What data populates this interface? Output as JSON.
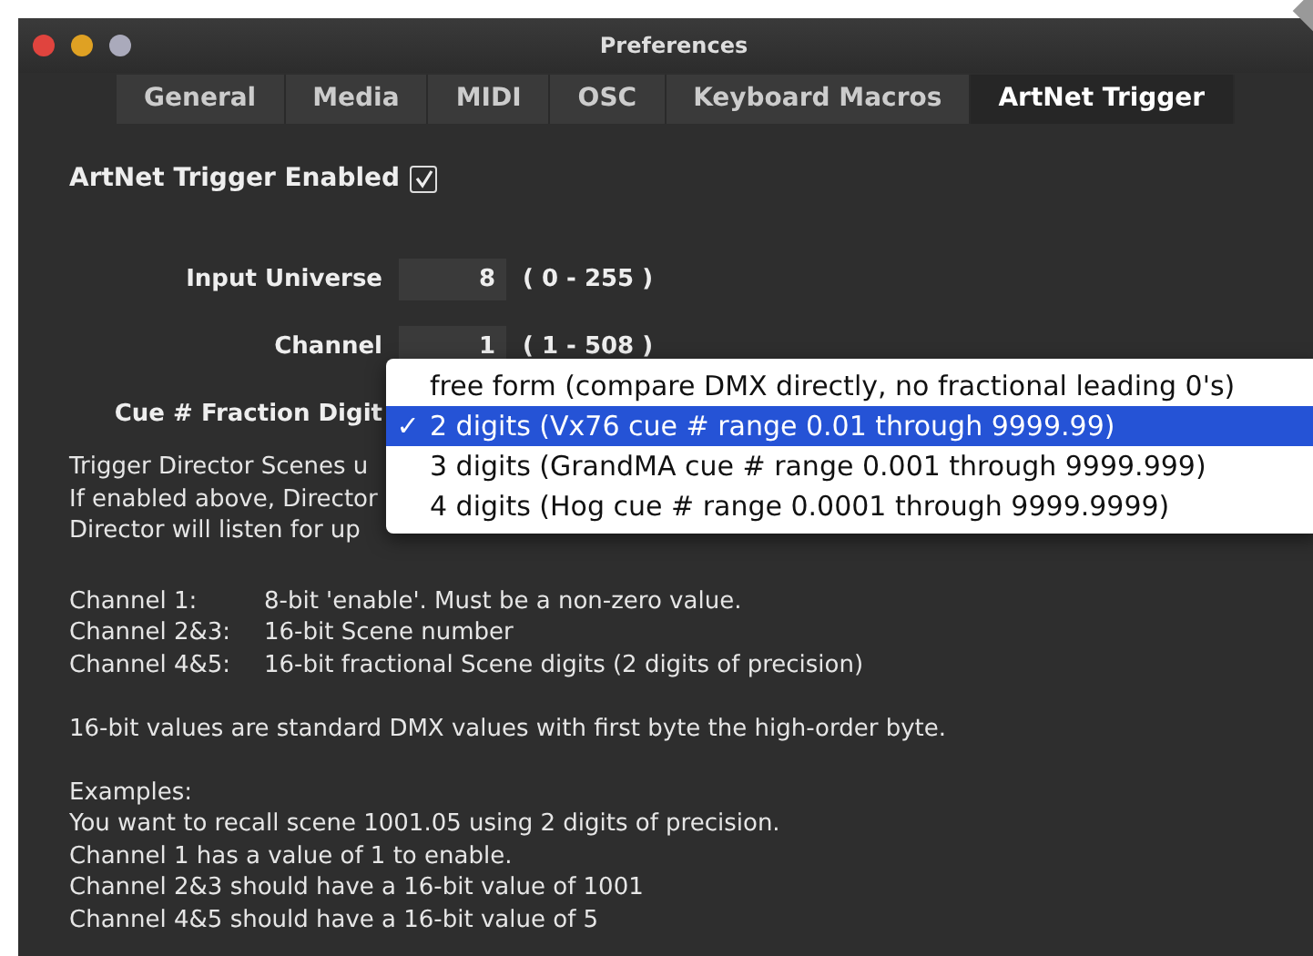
{
  "window": {
    "title": "Preferences"
  },
  "tabs": [
    {
      "label": "General",
      "selected": false
    },
    {
      "label": "Media",
      "selected": false
    },
    {
      "label": "MIDI",
      "selected": false
    },
    {
      "label": "OSC",
      "selected": false
    },
    {
      "label": "Keyboard Macros",
      "selected": false
    },
    {
      "label": "ArtNet Trigger",
      "selected": true
    }
  ],
  "enabled": {
    "label": "ArtNet Trigger Enabled",
    "checked": true
  },
  "fields": [
    {
      "label": "Input Universe",
      "value": "8",
      "range": "( 0 - 255 )"
    },
    {
      "label": "Channel",
      "value": "1",
      "range": "( 1 - 508 )"
    }
  ],
  "fraction": {
    "label": "Cue # Fraction Digit"
  },
  "intro_lines": [
    "Trigger Director Scenes u",
    "If enabled above, Director",
    "Director will listen for up"
  ],
  "channel_rows": [
    {
      "name": "Channel 1:",
      "desc": "8-bit 'enable'.   Must be a non-zero value."
    },
    {
      "name": "Channel 2&3:",
      "desc": "16-bit Scene number"
    },
    {
      "name": "Channel 4&5:",
      "desc": "16-bit fractional Scene digits (2 digits of precision)"
    }
  ],
  "note": "16-bit values are standard DMX values with first byte the high-order byte.",
  "examples": [
    "Examples:",
    "You want to recall scene 1001.05 using 2 digits of precision.",
    "Channel 1 has a value of 1 to enable.",
    "Channel 2&3 should have a 16-bit value of 1001",
    "Channel 4&5 should have a 16-bit value of 5"
  ],
  "menu": [
    {
      "label": "free form (compare DMX directly, no fractional leading 0's)",
      "selected": false
    },
    {
      "label": "2 digits (Vx76 cue # range 0.01 through 9999.99)",
      "selected": true,
      "check": "✓"
    },
    {
      "label": "3 digits (GrandMA cue # range 0.001 through 9999.999)",
      "selected": false
    },
    {
      "label": "4 digits (Hog cue # range 0.0001 through 9999.9999)",
      "selected": false
    }
  ]
}
